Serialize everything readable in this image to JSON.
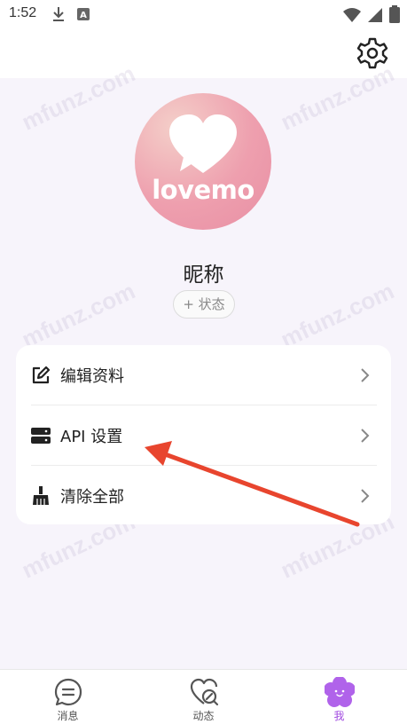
{
  "status_bar": {
    "time": "1:52",
    "icons": [
      "download-icon",
      "a-icon",
      "wifi-icon",
      "signal-icon",
      "battery-icon"
    ]
  },
  "header": {
    "settings_icon": "gear-icon"
  },
  "profile": {
    "avatar_text": "lovemo",
    "nickname": "昵称",
    "status_chip": "+ 状态"
  },
  "menu": {
    "items": [
      {
        "label": "编辑资料",
        "icon": "edit-icon"
      },
      {
        "label": "API 设置",
        "icon": "server-icon"
      },
      {
        "label": "清除全部",
        "icon": "broom-icon"
      }
    ]
  },
  "watermark": "mfunz.com",
  "tabs": [
    {
      "label": "消息",
      "icon": "chat-icon",
      "active": false
    },
    {
      "label": "动态",
      "icon": "heart-search-icon",
      "active": false
    },
    {
      "label": "我",
      "icon": "flower-face-icon",
      "active": true
    }
  ],
  "colors": {
    "accent": "#a24be0",
    "annotation_arrow": "#e8452e",
    "avatar": "#ee9fae",
    "background": "#f7f4fb"
  }
}
